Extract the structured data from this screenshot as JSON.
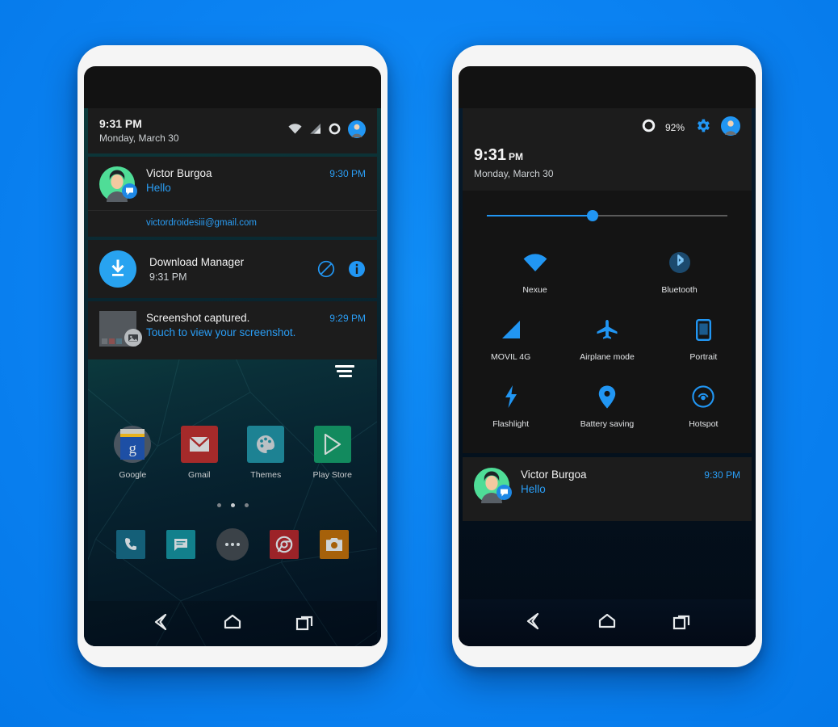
{
  "background_color": "#0d86f5",
  "accent_color": "#2196f3",
  "left_phone": {
    "name": "notification-shade-phone",
    "status_bar": {
      "time": "9:31 PM",
      "date": "Monday, March 30",
      "icons": [
        "wifi-icon",
        "signal-icon",
        "circle-icon",
        "user-avatar-icon"
      ]
    },
    "notifications": [
      {
        "id": "hangouts",
        "app_icon": "person-avatar-icon",
        "badge_icon": "hangouts-badge-icon",
        "title": "Victor Burgoa",
        "subtitle": "Hello",
        "time": "9:30 PM",
        "extra": "victordroidesiii@gmail.com"
      },
      {
        "id": "download-manager",
        "app_icon": "download-icon",
        "title": "Download Manager",
        "subtitle": "9:31 PM",
        "actions": [
          "cancel-icon",
          "info-icon"
        ]
      },
      {
        "id": "screenshot",
        "app_icon": "screenshot-thumbnail",
        "badge_icon": "image-badge-icon",
        "title": "Screenshot captured.",
        "subtitle": "Touch to view your screenshot.",
        "time": "9:29 PM"
      }
    ],
    "home_screen": {
      "menu_icon": "hamburger-menu-icon",
      "apps": [
        {
          "label": "Google",
          "icon": "google-icon",
          "color": "#2d5aa8"
        },
        {
          "label": "Gmail",
          "icon": "gmail-icon",
          "color": "#a52a2a"
        },
        {
          "label": "Themes",
          "icon": "themes-icon",
          "color": "#1d8293"
        },
        {
          "label": "Play Store",
          "icon": "playstore-icon",
          "color": "#128a5e"
        }
      ],
      "page_dots": {
        "count": 3,
        "active_index": 1
      },
      "dock": [
        {
          "name": "phone-app",
          "icon": "phone-icon",
          "color": "#145f78"
        },
        {
          "name": "messages-app",
          "icon": "message-icon",
          "color": "#12808c"
        },
        {
          "name": "app-drawer",
          "icon": "dots-icon",
          "color": "#3b4248"
        },
        {
          "name": "chrome-app",
          "icon": "chrome-icon",
          "color": "#9c2328"
        },
        {
          "name": "camera-app",
          "icon": "camera-icon",
          "color": "#a6610a"
        }
      ],
      "nav_bar": [
        "back-icon",
        "home-icon",
        "recents-icon"
      ]
    }
  },
  "right_phone": {
    "name": "quick-settings-phone",
    "header": {
      "battery_icon": "battery-circle-icon",
      "battery_percent": "92%",
      "settings_icon": "gear-icon",
      "avatar_icon": "user-avatar-icon",
      "time": "9:31",
      "time_meridiem": "PM",
      "date": "Monday, March 30"
    },
    "brightness_slider": {
      "name": "brightness-slider",
      "value_percent": 44
    },
    "tiles": [
      {
        "label": "Nexue",
        "icon": "wifi-icon"
      },
      {
        "label": "Bluetooth",
        "icon": "bluetooth-icon"
      },
      {
        "label": "MOVIL 4G",
        "icon": "cellular-icon"
      },
      {
        "label": "Airplane mode",
        "icon": "airplane-icon"
      },
      {
        "label": "Portrait",
        "icon": "rotation-icon"
      },
      {
        "label": "Flashlight",
        "icon": "flashlight-icon"
      },
      {
        "label": "Battery saving",
        "icon": "location-pin-icon"
      },
      {
        "label": "Hotspot",
        "icon": "hotspot-icon"
      }
    ],
    "notification": {
      "app_icon": "person-avatar-icon",
      "badge_icon": "hangouts-badge-icon",
      "title": "Victor Burgoa",
      "subtitle": "Hello",
      "time": "9:30 PM"
    },
    "nav_bar": [
      "back-icon",
      "home-icon",
      "recents-icon"
    ]
  }
}
